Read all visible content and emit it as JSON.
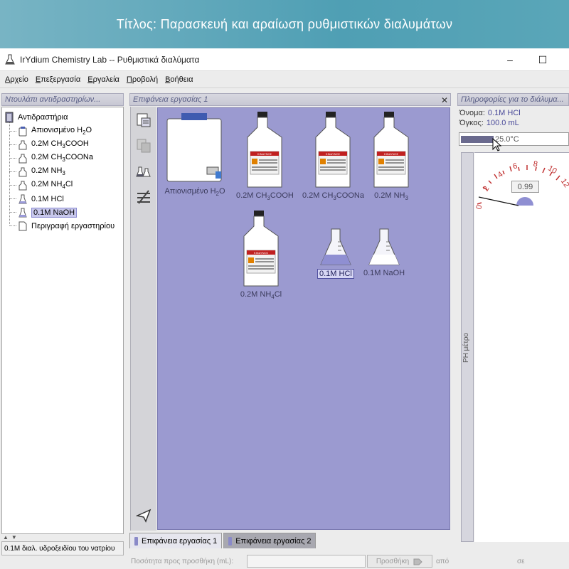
{
  "banner": {
    "title": "Τίτλος:  Παρασκευή και αραίωση ρυθμιστικών διαλυμάτων"
  },
  "window": {
    "title": "IrYdium Chemistry Lab -- Ρυθμιστικά διαλύματα",
    "minimize_glyph": "–",
    "maximize_glyph": "☐"
  },
  "menu": [
    "Αρχείο",
    "Επεξεργασία",
    "Εργαλεία",
    "Προβολή",
    "Βοήθεια"
  ],
  "left_panel": {
    "header": "Ντουλάπι αντιδραστηρίων...",
    "root": "Αντιδραστήρια",
    "items": [
      {
        "label": "Απιονισμένο H",
        "sub": "2",
        "tail": "O",
        "icon": "water-jug-icon"
      },
      {
        "label": "0.2M CH",
        "sub": "3",
        "tail": "COOH",
        "icon": "flask-icon"
      },
      {
        "label": "0.2M CH",
        "sub": "3",
        "tail": "COONa",
        "icon": "flask-icon"
      },
      {
        "label": "0.2M NH",
        "sub": "3",
        "tail": "",
        "icon": "flask-icon"
      },
      {
        "label": "0.2M NH",
        "sub": "4",
        "tail": "Cl",
        "icon": "flask-icon"
      },
      {
        "label": "0.1M HCl",
        "sub": "",
        "tail": "",
        "icon": "erlenmeyer-icon"
      },
      {
        "label": "0.1M NaOH",
        "sub": "",
        "tail": "",
        "icon": "erlenmeyer-icon"
      },
      {
        "label": "Περιγραφή εργαστηρίου",
        "sub": "",
        "tail": "",
        "icon": "document-icon"
      }
    ],
    "status": "0.1M διαλ. υδροξειδίου του νατρίου"
  },
  "workspace": {
    "header": "Επιφάνεια εργασίας 1",
    "close_glyph": "✕",
    "items": [
      {
        "label": "Απιονισμένο H",
        "sub": "2",
        "tail": "O"
      },
      {
        "label": "0.2M CH",
        "sub": "3",
        "tail": "COOH"
      },
      {
        "label": "0.2M CH",
        "sub": "3",
        "tail": "COONa"
      },
      {
        "label": "0.2M NH",
        "sub": "3",
        "tail": ""
      },
      {
        "label": "0.2M NH",
        "sub": "4",
        "tail": "Cl"
      },
      {
        "label": "0.1M HCl",
        "sub": "",
        "tail": ""
      },
      {
        "label": "0.1M NaOH",
        "sub": "",
        "tail": ""
      }
    ],
    "bottle_label_text": "ΚΙΝΔΥΝΟΣ",
    "tabs": [
      "Επιφάνεια εργασίας 1",
      "Επιφάνεια εργασίας 2"
    ]
  },
  "right_panel": {
    "header": "Πληροφορίες για το διάλυμα...",
    "name_label": "Όνομα:",
    "name_value": "0.1M HCl",
    "volume_label": "Όγκος:",
    "volume_value": "100.0 mL",
    "temperature": "25.0°C",
    "ph_label": "PH μέτρο",
    "ph_value": "0.99",
    "gauge_ticks": [
      "0",
      "2",
      "4",
      "6",
      "8",
      "10",
      "12"
    ]
  },
  "bottom": {
    "quantity_label": "Ποσότητα προς προσθήκη (mL):",
    "add_button": "Προσθήκη",
    "from_label": "από",
    "to_label": "σε"
  }
}
